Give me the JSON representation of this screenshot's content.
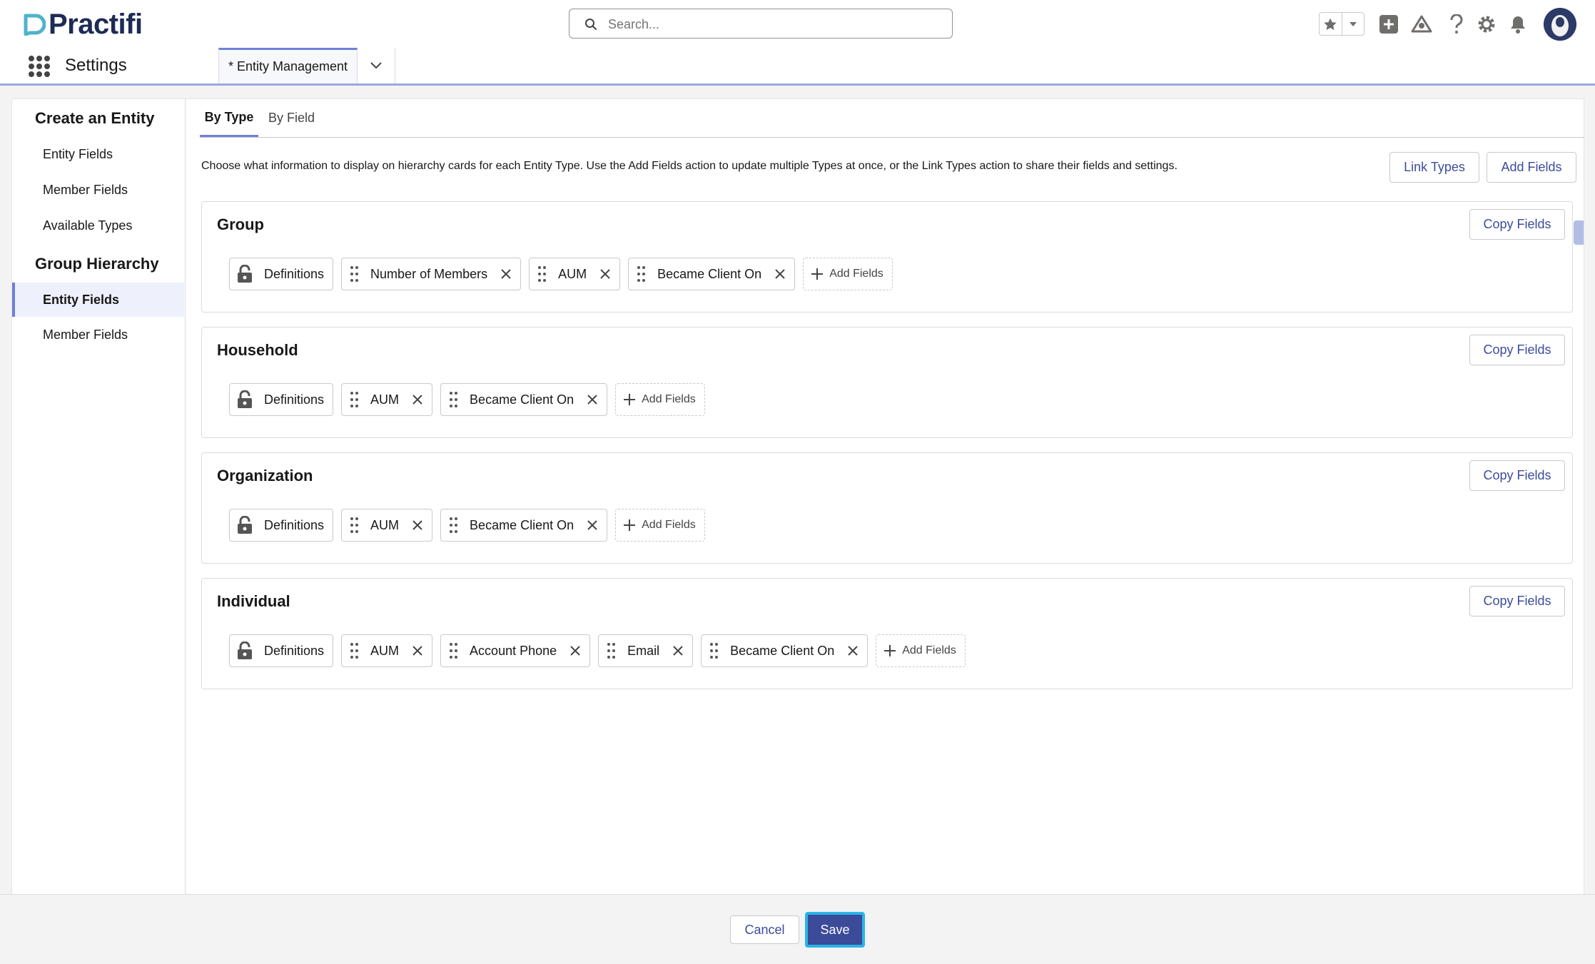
{
  "header": {
    "logo_text": "Practifi",
    "search_placeholder": "Search...",
    "icons": [
      "star-icon",
      "chevron-down-icon",
      "add-icon",
      "trailhead-icon",
      "help-icon",
      "gear-icon",
      "bell-icon",
      "avatar"
    ]
  },
  "nav": {
    "app_name": "Settings",
    "tab_label": "* Entity Management"
  },
  "sidebar": {
    "sections": [
      {
        "title": "Create an Entity",
        "items": [
          "Entity Fields",
          "Member Fields",
          "Available Types"
        ]
      },
      {
        "title": "Group Hierarchy",
        "items": [
          "Entity Fields",
          "Member Fields"
        ]
      }
    ],
    "active_item": "Group Hierarchy / Entity Fields"
  },
  "tabs": [
    "By Type",
    "By Field"
  ],
  "description": "Choose what information to display on hierarchy cards for each Entity Type. Use the Add Fields action to update multiple Types at once, or the Link Types action to share their fields and settings.",
  "actions": {
    "link_types": "Link Types",
    "add_fields": "Add Fields"
  },
  "cards": [
    {
      "title": "Group",
      "copy_label": "Copy Fields",
      "locked": "Definitions",
      "fields": [
        "Number of Members",
        "AUM",
        "Became Client On"
      ],
      "add_label": "Add Fields"
    },
    {
      "title": "Household",
      "copy_label": "Copy Fields",
      "locked": "Definitions",
      "fields": [
        "AUM",
        "Became Client On"
      ],
      "add_label": "Add Fields"
    },
    {
      "title": "Organization",
      "copy_label": "Copy Fields",
      "locked": "Definitions",
      "fields": [
        "AUM",
        "Became Client On"
      ],
      "add_label": "Add Fields"
    },
    {
      "title": "Individual",
      "copy_label": "Copy Fields",
      "locked": "Definitions",
      "fields": [
        "AUM",
        "Account Phone",
        "Email",
        "Became Client On"
      ],
      "add_label": "Add Fields"
    }
  ],
  "footer": {
    "cancel": "Cancel",
    "save": "Save"
  },
  "colors": {
    "brand_navy": "#1d2b55",
    "accent": "#6e80d8",
    "link": "#3c4c9e",
    "save_bg": "#3b4a99",
    "focus_ring": "#2ab5e8"
  }
}
